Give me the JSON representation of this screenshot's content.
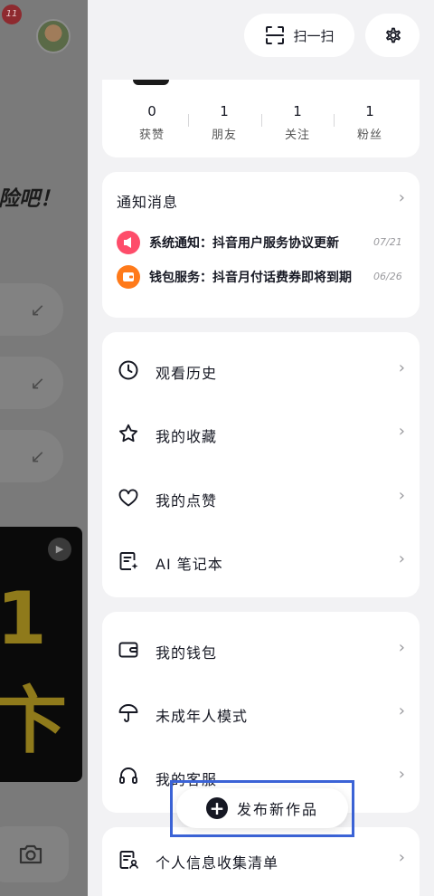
{
  "background": {
    "badge": "11",
    "headline": "险吧！",
    "pill_arrow": "↙",
    "video_text_top": "1",
    "video_text_bottom": "卞"
  },
  "header": {
    "scan_label": "扫一扫"
  },
  "stats": [
    {
      "value": "0",
      "label": "获赞"
    },
    {
      "value": "1",
      "label": "朋友"
    },
    {
      "value": "1",
      "label": "关注"
    },
    {
      "value": "1",
      "label": "粉丝"
    }
  ],
  "notifications": {
    "title": "通知消息",
    "items": [
      {
        "text": "系统通知：抖音用户服务协议更新",
        "date": "07/21",
        "icon": "megaphone-icon",
        "color": "#fe4d6a"
      },
      {
        "text": "钱包服务：抖音月付话费券即将到期",
        "date": "06/26",
        "icon": "wallet-icon",
        "color": "#ff7a1a"
      }
    ]
  },
  "menu1": [
    {
      "label": "观看历史",
      "icon": "clock-icon"
    },
    {
      "label": "我的收藏",
      "icon": "star-icon"
    },
    {
      "label": "我的点赞",
      "icon": "heart-icon"
    },
    {
      "label": "AI 笔记本",
      "icon": "ai-notebook-icon"
    }
  ],
  "menu2": [
    {
      "label": "我的钱包",
      "icon": "wallet-icon"
    },
    {
      "label": "未成年人模式",
      "icon": "umbrella-icon"
    },
    {
      "label": "我的客服",
      "icon": "headset-icon"
    }
  ],
  "menu3": [
    {
      "label": "个人信息收集清单",
      "icon": "document-user-icon"
    }
  ],
  "publish": {
    "label": "发布新作品"
  },
  "chevron": "›"
}
